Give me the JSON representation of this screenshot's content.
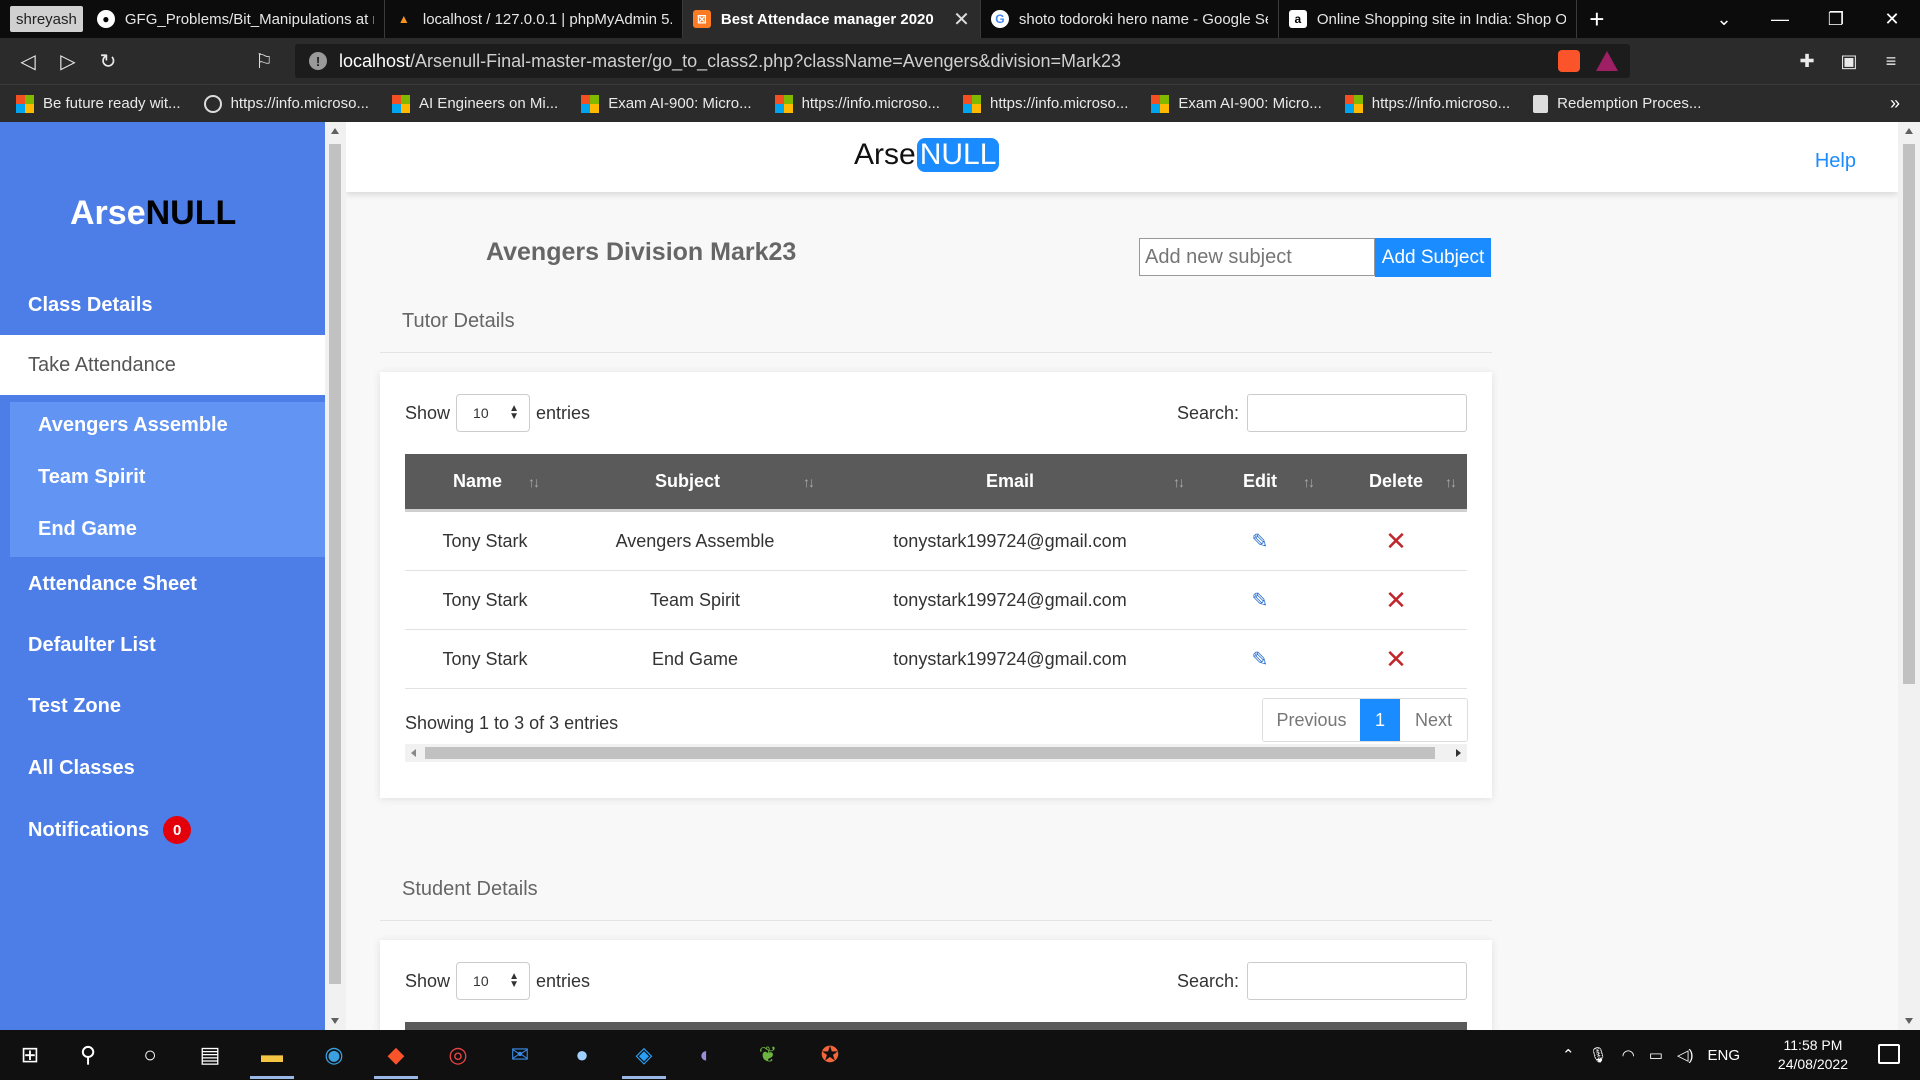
{
  "browser": {
    "profile": "shreyash",
    "tabs": [
      {
        "title": "GFG_Problems/Bit_Manipulations at m",
        "active": false,
        "icon": "github-icon"
      },
      {
        "title": "localhost / 127.0.0.1 | phpMyAdmin 5.",
        "active": false,
        "icon": "phpmyadmin-icon"
      },
      {
        "title": "Best Attendace manager 2020",
        "active": true,
        "icon": "xampp-icon"
      },
      {
        "title": "shoto todoroki hero name - Google Se",
        "active": false,
        "icon": "google-icon"
      },
      {
        "title": "Online Shopping site in India: Shop On",
        "active": false,
        "icon": "amazon-icon"
      }
    ],
    "url_host": "localhost",
    "url_path": "/Arsenull-Final-master-master/go_to_class2.php?className=Avengers&division=Mark23",
    "bookmarks": [
      {
        "label": "Be future ready wit...",
        "icon": "microsoft-icon"
      },
      {
        "label": "https://info.microso...",
        "icon": "globe-icon"
      },
      {
        "label": "AI Engineers on Mi...",
        "icon": "microsoft-icon"
      },
      {
        "label": "Exam AI-900: Micro...",
        "icon": "microsoft-icon"
      },
      {
        "label": "https://info.microso...",
        "icon": "microsoft-icon"
      },
      {
        "label": "https://info.microso...",
        "icon": "microsoft-icon"
      },
      {
        "label": "Exam AI-900: Micro...",
        "icon": "microsoft-icon"
      },
      {
        "label": "https://info.microso...",
        "icon": "microsoft-icon"
      },
      {
        "label": "Redemption Proces...",
        "icon": "document-icon"
      }
    ],
    "more": "»"
  },
  "sidebar": {
    "brand_prefix": "Arse",
    "brand_suffix": "NULL",
    "items": [
      {
        "label": "Class Details"
      },
      {
        "label": "Take Attendance",
        "active": true
      },
      {
        "label": "Attendance Sheet"
      },
      {
        "label": "Defaulter List"
      },
      {
        "label": "Test Zone"
      },
      {
        "label": "All Classes"
      },
      {
        "label": "Notifications",
        "badge": "0"
      }
    ],
    "submenu": [
      "Avengers Assemble",
      "Team Spirit",
      "End Game"
    ]
  },
  "topnav": {
    "logo_prefix": "Arse",
    "logo_suffix": "NULL",
    "help": "Help"
  },
  "page": {
    "heading": "Avengers Division Mark23",
    "subject_placeholder": "Add new subject",
    "add_subject_label": "Add Subject"
  },
  "tutor_section": {
    "title": "Tutor Details",
    "show_label": "Show",
    "entries_value": "10",
    "entries_label": "entries",
    "search_label": "Search:",
    "columns": [
      "Name",
      "Subject",
      "Email",
      "Edit",
      "Delete"
    ],
    "rows": [
      {
        "name": "Tony Stark",
        "subject": "Avengers Assemble",
        "email": "tonystark199724@gmail.com"
      },
      {
        "name": "Tony Stark",
        "subject": "Team Spirit",
        "email": "tonystark199724@gmail.com"
      },
      {
        "name": "Tony Stark",
        "subject": "End Game",
        "email": "tonystark199724@gmail.com"
      }
    ],
    "info": "Showing 1 to 3 of 3 entries",
    "pager": {
      "previous": "Previous",
      "current": "1",
      "next": "Next"
    }
  },
  "student_section": {
    "title": "Student Details",
    "show_label": "Show",
    "entries_value": "10",
    "entries_label": "entries",
    "search_label": "Search:"
  },
  "taskbar": {
    "lang": "ENG",
    "time": "11:58 PM",
    "date": "24/08/2022"
  },
  "colors": {
    "sidebar": "#4d7de6",
    "submenu": "#6294f3",
    "accent": "#1a8cff",
    "table_header": "#5a5a5a",
    "delete": "#c0272d"
  }
}
